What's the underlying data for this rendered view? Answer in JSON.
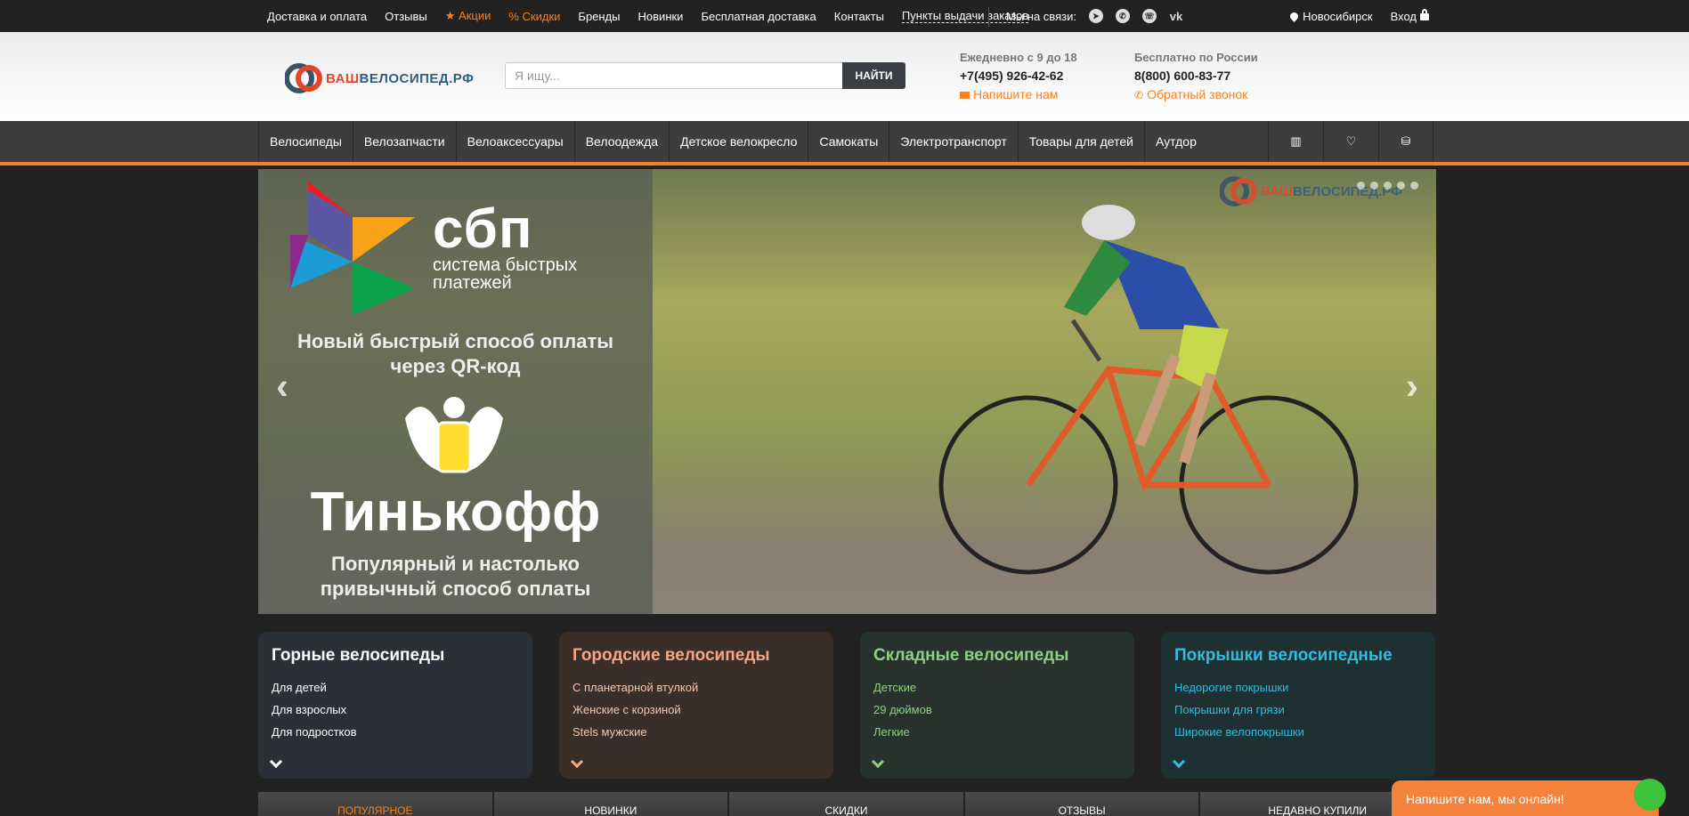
{
  "topbar": {
    "links": [
      "Доставка и оплата",
      "Отзывы",
      "★ Акции",
      "% Скидки",
      "Бренды",
      "Новинки",
      "Бесплатная доставка",
      "Контакты",
      "Пункты выдачи заказов"
    ],
    "contact_label": "Мы на связи:",
    "social": [
      "telegram-icon",
      "whatsapp-icon",
      "viber-icon",
      "vk-icon"
    ],
    "city": "Новосибирск",
    "login": "Вход"
  },
  "header": {
    "logo_part1": "ВАШ",
    "logo_part2": "ВЕЛОСИПЕД.РФ",
    "search_placeholder": "Я ищу...",
    "search_button": "НАЙТИ",
    "contact1": {
      "label": "Ежедневно с 9 до 18",
      "phone": "+7(495) 926-42-62",
      "action": "Напишите нам"
    },
    "contact2": {
      "label": "Бесплатно по России",
      "phone": "8(800) 600-83-77",
      "action": "Обратный звонок"
    }
  },
  "nav": {
    "items": [
      "Велосипеды",
      "Велозапчасти",
      "Велоаксессуары",
      "Велоодежда",
      "Детское велокресло",
      "Самокаты",
      "Электротранспорт",
      "Товары для детей",
      "Аутдор"
    ],
    "icons": [
      "compare-icon",
      "heart-icon",
      "basket-icon"
    ]
  },
  "slider": {
    "sbp_big": "сбп",
    "sbp_small1": "система быстрых",
    "sbp_small2": "платежей",
    "line1": "Новый быстрый способ оплаты",
    "line2": "через QR-код",
    "brand": "Тинькофф",
    "line3": "Популярный и настолько",
    "line4": "привычный способ оплаты",
    "prev": "‹",
    "next": "›"
  },
  "cards": [
    {
      "title": "Горные велосипеды",
      "items": [
        "Для детей",
        "Для взрослых",
        "Для подростков"
      ]
    },
    {
      "title": "Городские велосипеды",
      "items": [
        "С планетарной втулкой",
        "Женские с корзиной",
        "Stels мужские"
      ]
    },
    {
      "title": "Складные велосипеды",
      "items": [
        "Детские",
        "29 дюймов",
        "Легкие"
      ]
    },
    {
      "title": "Покрышки велосипедные",
      "items": [
        "Недорогие покрышки",
        "Покрышки для грязи",
        "Широкие велопокрышки"
      ]
    }
  ],
  "tabs": [
    "популярное",
    "новинки",
    "скидки",
    "отзывы",
    "недавно купили"
  ],
  "chat": {
    "label": "Напишите нам, мы онлайн!"
  },
  "colors": {
    "accent": "#f58220",
    "nav_bg": "#3d3d3d",
    "page_bg": "#222222"
  }
}
